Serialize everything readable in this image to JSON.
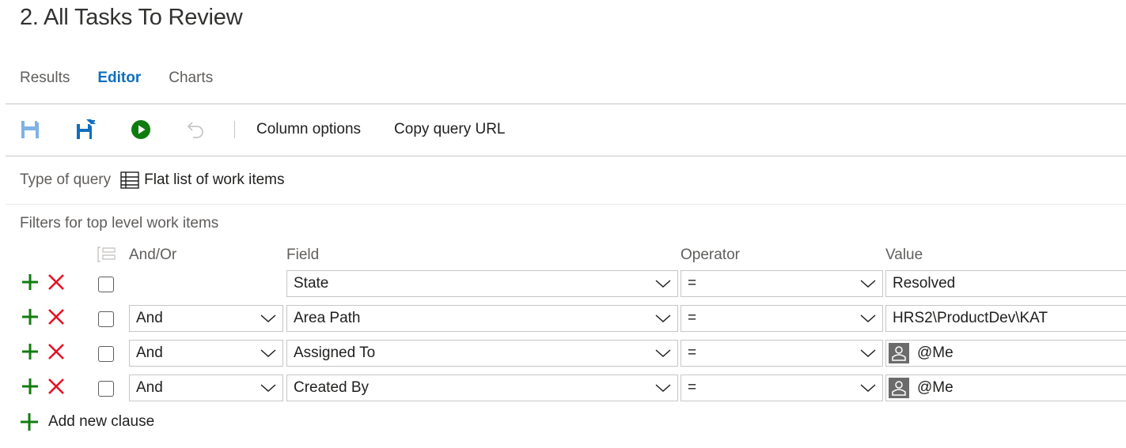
{
  "page": {
    "title": "2. All Tasks To Review"
  },
  "tabs": [
    {
      "label": "Results"
    },
    {
      "label": "Editor"
    },
    {
      "label": "Charts"
    }
  ],
  "toolbar": {
    "column_options": "Column options",
    "copy_query_url": "Copy query URL",
    "icons": [
      "save-icon",
      "save-as-icon",
      "run-query-icon",
      "undo-icon"
    ]
  },
  "query_type": {
    "label": "Type of query",
    "value": "Flat list of work items"
  },
  "filters": {
    "label": "Filters for top level work items",
    "headers": {
      "and_or": "And/Or",
      "field": "Field",
      "operator": "Operator",
      "value": "Value"
    },
    "rows": [
      {
        "and_or": "",
        "field": "State",
        "operator": "=",
        "value": "Resolved"
      },
      {
        "and_or": "And",
        "field": "Area Path",
        "operator": "=",
        "value": "HRS2\\ProductDev\\KAT"
      },
      {
        "and_or": "And",
        "field": "Assigned To",
        "operator": "=",
        "value": "@Me"
      },
      {
        "and_or": "And",
        "field": "Created By",
        "operator": "=",
        "value": "@Me"
      }
    ],
    "add_clause": "Add new clause"
  },
  "colors": {
    "accent": "#106ebe",
    "add_green": "#107c10",
    "delete_red": "#e81123"
  }
}
